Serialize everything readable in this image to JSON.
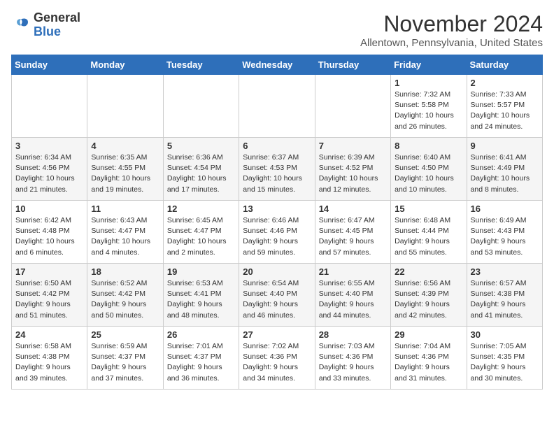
{
  "logo": {
    "general": "General",
    "blue": "Blue"
  },
  "title": "November 2024",
  "subtitle": "Allentown, Pennsylvania, United States",
  "headers": [
    "Sunday",
    "Monday",
    "Tuesday",
    "Wednesday",
    "Thursday",
    "Friday",
    "Saturday"
  ],
  "weeks": [
    [
      {
        "day": "",
        "info": ""
      },
      {
        "day": "",
        "info": ""
      },
      {
        "day": "",
        "info": ""
      },
      {
        "day": "",
        "info": ""
      },
      {
        "day": "",
        "info": ""
      },
      {
        "day": "1",
        "info": "Sunrise: 7:32 AM\nSunset: 5:58 PM\nDaylight: 10 hours and 26 minutes."
      },
      {
        "day": "2",
        "info": "Sunrise: 7:33 AM\nSunset: 5:57 PM\nDaylight: 10 hours and 24 minutes."
      }
    ],
    [
      {
        "day": "3",
        "info": "Sunrise: 6:34 AM\nSunset: 4:56 PM\nDaylight: 10 hours and 21 minutes."
      },
      {
        "day": "4",
        "info": "Sunrise: 6:35 AM\nSunset: 4:55 PM\nDaylight: 10 hours and 19 minutes."
      },
      {
        "day": "5",
        "info": "Sunrise: 6:36 AM\nSunset: 4:54 PM\nDaylight: 10 hours and 17 minutes."
      },
      {
        "day": "6",
        "info": "Sunrise: 6:37 AM\nSunset: 4:53 PM\nDaylight: 10 hours and 15 minutes."
      },
      {
        "day": "7",
        "info": "Sunrise: 6:39 AM\nSunset: 4:52 PM\nDaylight: 10 hours and 12 minutes."
      },
      {
        "day": "8",
        "info": "Sunrise: 6:40 AM\nSunset: 4:50 PM\nDaylight: 10 hours and 10 minutes."
      },
      {
        "day": "9",
        "info": "Sunrise: 6:41 AM\nSunset: 4:49 PM\nDaylight: 10 hours and 8 minutes."
      }
    ],
    [
      {
        "day": "10",
        "info": "Sunrise: 6:42 AM\nSunset: 4:48 PM\nDaylight: 10 hours and 6 minutes."
      },
      {
        "day": "11",
        "info": "Sunrise: 6:43 AM\nSunset: 4:47 PM\nDaylight: 10 hours and 4 minutes."
      },
      {
        "day": "12",
        "info": "Sunrise: 6:45 AM\nSunset: 4:47 PM\nDaylight: 10 hours and 2 minutes."
      },
      {
        "day": "13",
        "info": "Sunrise: 6:46 AM\nSunset: 4:46 PM\nDaylight: 9 hours and 59 minutes."
      },
      {
        "day": "14",
        "info": "Sunrise: 6:47 AM\nSunset: 4:45 PM\nDaylight: 9 hours and 57 minutes."
      },
      {
        "day": "15",
        "info": "Sunrise: 6:48 AM\nSunset: 4:44 PM\nDaylight: 9 hours and 55 minutes."
      },
      {
        "day": "16",
        "info": "Sunrise: 6:49 AM\nSunset: 4:43 PM\nDaylight: 9 hours and 53 minutes."
      }
    ],
    [
      {
        "day": "17",
        "info": "Sunrise: 6:50 AM\nSunset: 4:42 PM\nDaylight: 9 hours and 51 minutes."
      },
      {
        "day": "18",
        "info": "Sunrise: 6:52 AM\nSunset: 4:42 PM\nDaylight: 9 hours and 50 minutes."
      },
      {
        "day": "19",
        "info": "Sunrise: 6:53 AM\nSunset: 4:41 PM\nDaylight: 9 hours and 48 minutes."
      },
      {
        "day": "20",
        "info": "Sunrise: 6:54 AM\nSunset: 4:40 PM\nDaylight: 9 hours and 46 minutes."
      },
      {
        "day": "21",
        "info": "Sunrise: 6:55 AM\nSunset: 4:40 PM\nDaylight: 9 hours and 44 minutes."
      },
      {
        "day": "22",
        "info": "Sunrise: 6:56 AM\nSunset: 4:39 PM\nDaylight: 9 hours and 42 minutes."
      },
      {
        "day": "23",
        "info": "Sunrise: 6:57 AM\nSunset: 4:38 PM\nDaylight: 9 hours and 41 minutes."
      }
    ],
    [
      {
        "day": "24",
        "info": "Sunrise: 6:58 AM\nSunset: 4:38 PM\nDaylight: 9 hours and 39 minutes."
      },
      {
        "day": "25",
        "info": "Sunrise: 6:59 AM\nSunset: 4:37 PM\nDaylight: 9 hours and 37 minutes."
      },
      {
        "day": "26",
        "info": "Sunrise: 7:01 AM\nSunset: 4:37 PM\nDaylight: 9 hours and 36 minutes."
      },
      {
        "day": "27",
        "info": "Sunrise: 7:02 AM\nSunset: 4:36 PM\nDaylight: 9 hours and 34 minutes."
      },
      {
        "day": "28",
        "info": "Sunrise: 7:03 AM\nSunset: 4:36 PM\nDaylight: 9 hours and 33 minutes."
      },
      {
        "day": "29",
        "info": "Sunrise: 7:04 AM\nSunset: 4:36 PM\nDaylight: 9 hours and 31 minutes."
      },
      {
        "day": "30",
        "info": "Sunrise: 7:05 AM\nSunset: 4:35 PM\nDaylight: 9 hours and 30 minutes."
      }
    ]
  ]
}
